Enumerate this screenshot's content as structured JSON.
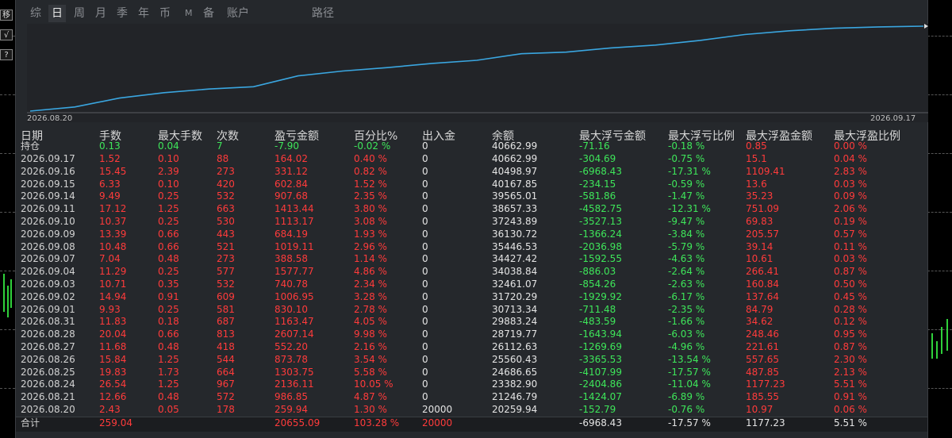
{
  "tabs": [
    "综",
    "日",
    "周",
    "月",
    "季",
    "年",
    "币",
    "M",
    "备",
    "账户",
    "路径"
  ],
  "active_tab": "日",
  "side_buttons": [
    "移",
    "√",
    "?"
  ],
  "chart_data": {
    "type": "line",
    "x_start_label": "2026.08.20",
    "x_end_label": "2026.09.17",
    "series": [
      {
        "color": "#3aa6e0",
        "x": [
          "2026.08.20",
          "2026.08.21",
          "2026.08.24",
          "2026.08.25",
          "2026.08.26",
          "2026.08.27",
          "2026.08.28",
          "2026.08.31",
          "2026.09.01",
          "2026.09.02",
          "2026.09.03",
          "2026.09.04",
          "2026.09.07",
          "2026.09.08",
          "2026.09.09",
          "2026.09.10",
          "2026.09.11",
          "2026.09.14",
          "2026.09.15",
          "2026.09.16",
          "2026.09.17"
        ],
        "values": [
          20259.94,
          21246.79,
          23382.9,
          24686.65,
          25560.43,
          26112.63,
          28719.77,
          29883.24,
          30713.34,
          31720.29,
          32461.07,
          34038.84,
          34427.42,
          35446.53,
          36130.72,
          37243.89,
          38657.33,
          39565.01,
          40167.85,
          40498.97,
          40662.99
        ]
      }
    ],
    "ylim": [
      20259.94,
      40662.99
    ]
  },
  "columns": [
    "日期",
    "手数",
    "最大手数",
    "次数",
    "盈亏金额",
    "百分比%",
    "出入金",
    "余额",
    "最大浮亏金额",
    "最大浮亏比例",
    "最大浮盈金额",
    "最大浮盈比例"
  ],
  "position_row": {
    "label": "持仓",
    "lots": "0.13",
    "max_lots": "0.04",
    "count": "7",
    "pnl": "-7.90",
    "pct": "-0.02 %",
    "flow": "0",
    "balance": "40662.99",
    "max_float_loss": "-71.16",
    "max_float_loss_pct": "-0.18 %",
    "max_float_profit": "0.85",
    "max_float_profit_pct": "0.00 %"
  },
  "rows": [
    [
      "2026.09.17",
      "1.52",
      "0.10",
      "88",
      "164.02",
      "0.40 %",
      "0",
      "40662.99",
      "-304.69",
      "-0.75 %",
      "15.1",
      "0.04 %"
    ],
    [
      "2026.09.16",
      "15.45",
      "2.39",
      "273",
      "331.12",
      "0.82 %",
      "0",
      "40498.97",
      "-6968.43",
      "-17.31 %",
      "1109.41",
      "2.83 %"
    ],
    [
      "2026.09.15",
      "6.33",
      "0.10",
      "420",
      "602.84",
      "1.52 %",
      "0",
      "40167.85",
      "-234.15",
      "-0.59 %",
      "13.6",
      "0.03 %"
    ],
    [
      "2026.09.14",
      "9.49",
      "0.25",
      "532",
      "907.68",
      "2.35 %",
      "0",
      "39565.01",
      "-581.86",
      "-1.47 %",
      "35.23",
      "0.09 %"
    ],
    [
      "2026.09.11",
      "17.12",
      "1.25",
      "663",
      "1413.44",
      "3.80 %",
      "0",
      "38657.33",
      "-4582.75",
      "-12.31 %",
      "751.09",
      "2.06 %"
    ],
    [
      "2026.09.10",
      "10.37",
      "0.25",
      "530",
      "1113.17",
      "3.08 %",
      "0",
      "37243.89",
      "-3527.13",
      "-9.47 %",
      "69.83",
      "0.19 %"
    ],
    [
      "2026.09.09",
      "13.39",
      "0.66",
      "443",
      "684.19",
      "1.93 %",
      "0",
      "36130.72",
      "-1366.24",
      "-3.84 %",
      "205.57",
      "0.57 %"
    ],
    [
      "2026.09.08",
      "10.48",
      "0.66",
      "521",
      "1019.11",
      "2.96 %",
      "0",
      "35446.53",
      "-2036.98",
      "-5.79 %",
      "39.14",
      "0.11 %"
    ],
    [
      "2026.09.07",
      "7.04",
      "0.48",
      "273",
      "388.58",
      "1.14 %",
      "0",
      "34427.42",
      "-1592.55",
      "-4.63 %",
      "10.61",
      "0.03 %"
    ],
    [
      "2026.09.04",
      "11.29",
      "0.25",
      "577",
      "1577.77",
      "4.86 %",
      "0",
      "34038.84",
      "-886.03",
      "-2.64 %",
      "266.41",
      "0.87 %"
    ],
    [
      "2026.09.03",
      "10.71",
      "0.35",
      "532",
      "740.78",
      "2.34 %",
      "0",
      "32461.07",
      "-854.26",
      "-2.63 %",
      "160.84",
      "0.50 %"
    ],
    [
      "2026.09.02",
      "14.94",
      "0.91",
      "609",
      "1006.95",
      "3.28 %",
      "0",
      "31720.29",
      "-1929.92",
      "-6.17 %",
      "137.64",
      "0.45 %"
    ],
    [
      "2026.09.01",
      "9.93",
      "0.25",
      "581",
      "830.10",
      "2.78 %",
      "0",
      "30713.34",
      "-711.48",
      "-2.35 %",
      "84.79",
      "0.28 %"
    ],
    [
      "2026.08.31",
      "11.83",
      "0.18",
      "687",
      "1163.47",
      "4.05 %",
      "0",
      "29883.24",
      "-483.59",
      "-1.66 %",
      "34.62",
      "0.12 %"
    ],
    [
      "2026.08.28",
      "20.04",
      "0.66",
      "813",
      "2607.14",
      "9.98 %",
      "0",
      "28719.77",
      "-1643.94",
      "-6.03 %",
      "248.46",
      "0.95 %"
    ],
    [
      "2026.08.27",
      "11.68",
      "0.48",
      "418",
      "552.20",
      "2.16 %",
      "0",
      "26112.63",
      "-1269.69",
      "-4.96 %",
      "221.61",
      "0.87 %"
    ],
    [
      "2026.08.26",
      "15.84",
      "1.25",
      "544",
      "873.78",
      "3.54 %",
      "0",
      "25560.43",
      "-3365.53",
      "-13.54 %",
      "557.65",
      "2.30 %"
    ],
    [
      "2026.08.25",
      "19.83",
      "1.73",
      "664",
      "1303.75",
      "5.58 %",
      "0",
      "24686.65",
      "-4107.99",
      "-17.57 %",
      "487.85",
      "2.13 %"
    ],
    [
      "2026.08.24",
      "26.54",
      "1.25",
      "967",
      "2136.11",
      "10.05 %",
      "0",
      "23382.90",
      "-2404.86",
      "-11.04 %",
      "1177.23",
      "5.51 %"
    ],
    [
      "2026.08.21",
      "12.66",
      "0.48",
      "572",
      "986.85",
      "4.87 %",
      "0",
      "21246.79",
      "-1424.07",
      "-6.89 %",
      "185.55",
      "0.91 %"
    ],
    [
      "2026.08.20",
      "2.43",
      "0.05",
      "178",
      "259.94",
      "1.30 %",
      "20000",
      "20259.94",
      "-152.79",
      "-0.76 %",
      "10.97",
      "0.06 %"
    ]
  ],
  "total_row": {
    "label": "合计",
    "lots": "259.04",
    "pnl": "20655.09",
    "pct": "103.28 %",
    "flow": "20000",
    "max_float_loss": "-6968.43",
    "max_float_loss_pct": "-17.57 %",
    "max_float_profit": "1177.23",
    "max_float_profit_pct": "5.51 %"
  },
  "colors": {
    "profit": "#ff3b3b",
    "loss": "#3ee65a",
    "line": "#3aa6e0",
    "panel_bg": "#25282c"
  }
}
